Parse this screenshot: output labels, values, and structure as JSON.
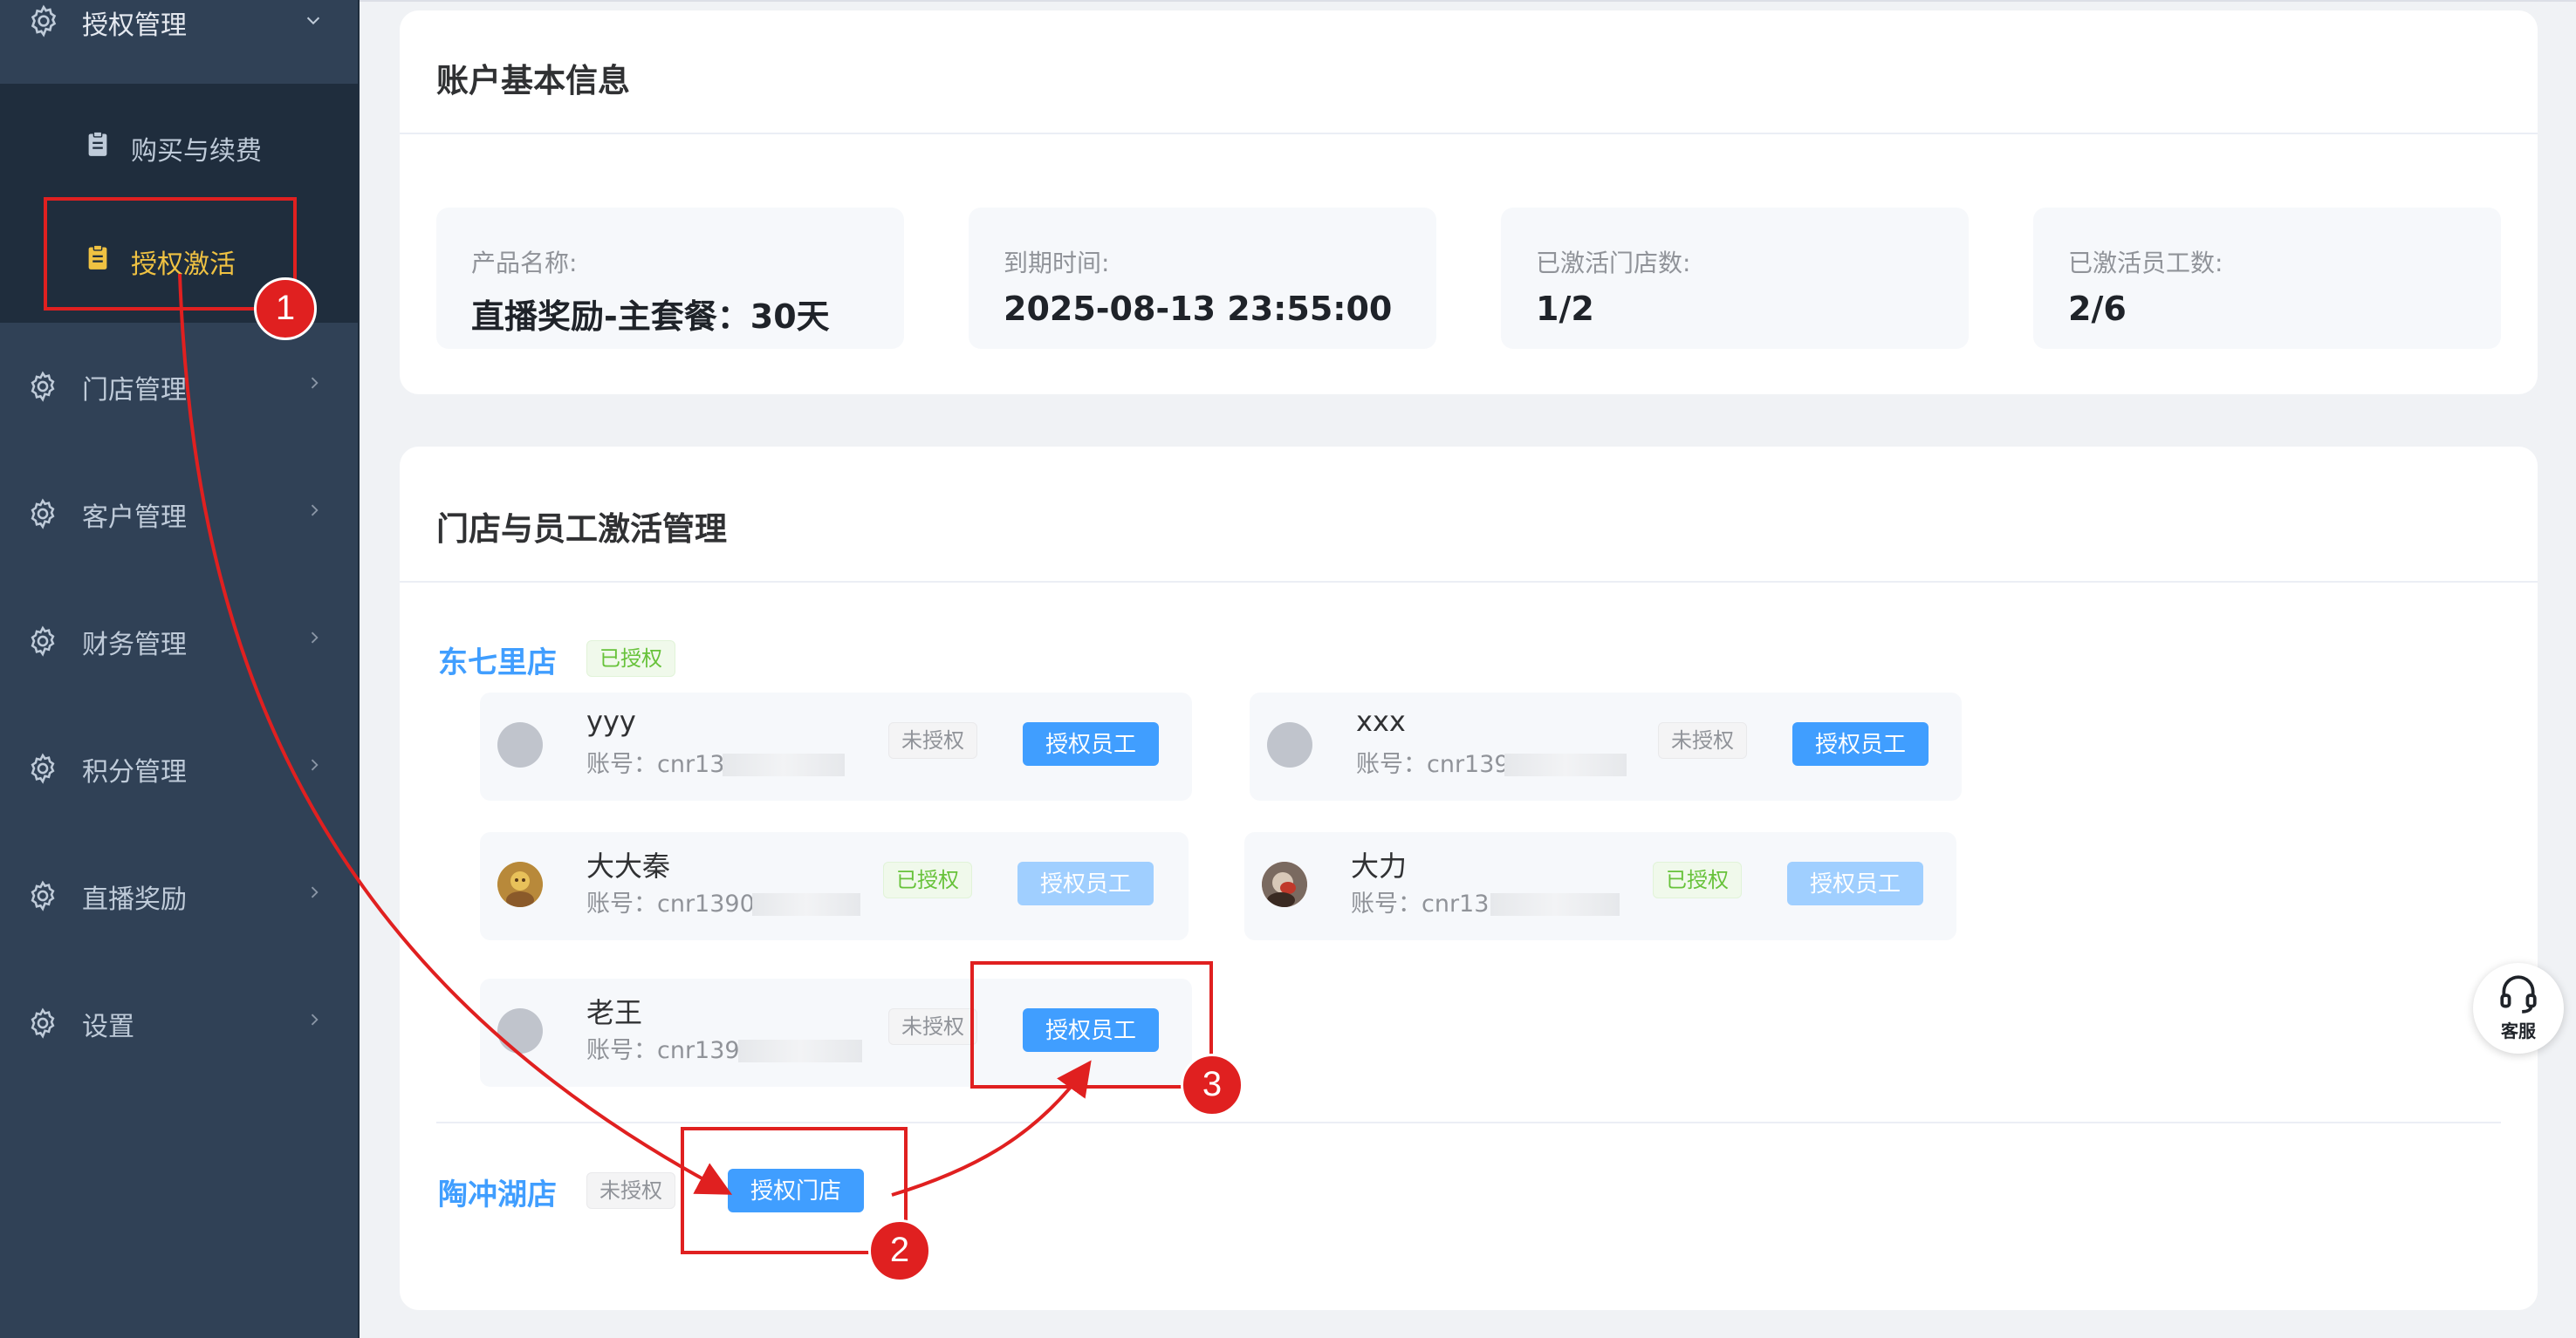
{
  "sidebar": {
    "group": {
      "label": "授权管理",
      "icon": "gear-icon",
      "expanded": true
    },
    "subitems": [
      {
        "label": "购买与续费",
        "icon": "clipboard-icon",
        "active": false
      },
      {
        "label": "授权激活",
        "icon": "clipboard-icon",
        "active": true
      }
    ],
    "items": [
      {
        "label": "门店管理",
        "icon": "gear-icon"
      },
      {
        "label": "客户管理",
        "icon": "gear-icon"
      },
      {
        "label": "财务管理",
        "icon": "gear-icon"
      },
      {
        "label": "积分管理",
        "icon": "gear-icon"
      },
      {
        "label": "直播奖励",
        "icon": "gear-icon"
      },
      {
        "label": "设置",
        "icon": "gear-icon"
      }
    ]
  },
  "account": {
    "title": "账户基本信息",
    "fields": [
      {
        "label": "产品名称:",
        "value": "直播奖励-主套餐：30天"
      },
      {
        "label": "到期时间:",
        "value": "2025-08-13 23:55:00"
      },
      {
        "label": "已激活门店数:",
        "value": "1/2"
      },
      {
        "label": "已激活员工数:",
        "value": "2/6"
      }
    ]
  },
  "activation": {
    "title": "门店与员工激活管理",
    "stores": [
      {
        "name": "东七里店",
        "status": "已授权",
        "employees": [
          {
            "name": "yyy",
            "account": "账号：cnr13",
            "status": "未授权",
            "button": "授权员工",
            "enabled": true
          },
          {
            "name": "xxx",
            "account": "账号：cnr139",
            "status": "未授权",
            "button": "授权员工",
            "enabled": true
          },
          {
            "name": "大大秦",
            "account": "账号：cnr1390",
            "status": "已授权",
            "button": "授权员工",
            "enabled": false
          },
          {
            "name": "大力",
            "account": "账号：cnr13",
            "status": "已授权",
            "button": "授权员工",
            "enabled": false
          },
          {
            "name": "老王",
            "account": "账号：cnr139",
            "status": "未授权",
            "button": "授权员工",
            "enabled": true
          }
        ]
      },
      {
        "name": "陶冲湖店",
        "status": "未授权",
        "button": "授权门店"
      }
    ]
  },
  "support": {
    "label": "客服",
    "icon": "headset-icon"
  },
  "annotations": [
    "1",
    "2",
    "3"
  ],
  "colors": {
    "accent": "#409eff",
    "sidebar_bg": "#304156",
    "active_menu": "#f0c242",
    "annotation": "#e02020",
    "success": "#67c23a"
  }
}
